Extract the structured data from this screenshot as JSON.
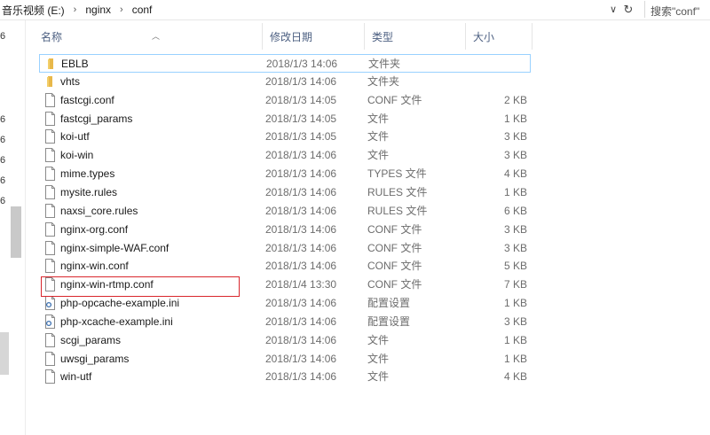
{
  "address": {
    "crumbs": [
      "音乐视频 (E:)",
      "nginx",
      "conf"
    ],
    "search_placeholder": "搜索\"conf\""
  },
  "nav_fragments": [
    "6",
    "6",
    "6",
    "6",
    "6",
    "6"
  ],
  "columns": {
    "name": "名称",
    "modified": "修改日期",
    "type": "类型",
    "size": "大小"
  },
  "files": [
    {
      "name": "EBLB",
      "date": "2018/1/3 14:06",
      "type": "文件夹",
      "size": "",
      "icon": "folder-icon"
    },
    {
      "name": "vhts",
      "date": "2018/1/3 14:06",
      "type": "文件夹",
      "size": "",
      "icon": "folder-icon"
    },
    {
      "name": "fastcgi.conf",
      "date": "2018/1/3 14:05",
      "type": "CONF 文件",
      "size": "2 KB",
      "icon": "file-icon"
    },
    {
      "name": "fastcgi_params",
      "date": "2018/1/3 14:05",
      "type": "文件",
      "size": "1 KB",
      "icon": "file-icon"
    },
    {
      "name": "koi-utf",
      "date": "2018/1/3 14:05",
      "type": "文件",
      "size": "3 KB",
      "icon": "file-icon"
    },
    {
      "name": "koi-win",
      "date": "2018/1/3 14:06",
      "type": "文件",
      "size": "3 KB",
      "icon": "file-icon"
    },
    {
      "name": "mime.types",
      "date": "2018/1/3 14:06",
      "type": "TYPES 文件",
      "size": "4 KB",
      "icon": "file-icon"
    },
    {
      "name": "mysite.rules",
      "date": "2018/1/3 14:06",
      "type": "RULES 文件",
      "size": "1 KB",
      "icon": "file-icon"
    },
    {
      "name": "naxsi_core.rules",
      "date": "2018/1/3 14:06",
      "type": "RULES 文件",
      "size": "6 KB",
      "icon": "file-icon"
    },
    {
      "name": "nginx-org.conf",
      "date": "2018/1/3 14:06",
      "type": "CONF 文件",
      "size": "3 KB",
      "icon": "file-icon"
    },
    {
      "name": "nginx-simple-WAF.conf",
      "date": "2018/1/3 14:06",
      "type": "CONF 文件",
      "size": "3 KB",
      "icon": "file-icon"
    },
    {
      "name": "nginx-win.conf",
      "date": "2018/1/3 14:06",
      "type": "CONF 文件",
      "size": "5 KB",
      "icon": "file-icon"
    },
    {
      "name": "nginx-win-rtmp.conf",
      "date": "2018/1/4 13:30",
      "type": "CONF 文件",
      "size": "7 KB",
      "icon": "file-icon"
    },
    {
      "name": "php-opcache-example.ini",
      "date": "2018/1/3 14:06",
      "type": "配置设置",
      "size": "1 KB",
      "icon": "settings-file-icon"
    },
    {
      "name": "php-xcache-example.ini",
      "date": "2018/1/3 14:06",
      "type": "配置设置",
      "size": "3 KB",
      "icon": "settings-file-icon"
    },
    {
      "name": "scgi_params",
      "date": "2018/1/3 14:06",
      "type": "文件",
      "size": "1 KB",
      "icon": "file-icon"
    },
    {
      "name": "uwsgi_params",
      "date": "2018/1/3 14:06",
      "type": "文件",
      "size": "1 KB",
      "icon": "file-icon"
    },
    {
      "name": "win-utf",
      "date": "2018/1/3 14:06",
      "type": "文件",
      "size": "4 KB",
      "icon": "file-icon"
    }
  ],
  "colors": {
    "header_text": "#4d6082",
    "selection_border": "#99d1ff",
    "highlight_box": "#d9262c",
    "folder": "#e8b84a"
  }
}
